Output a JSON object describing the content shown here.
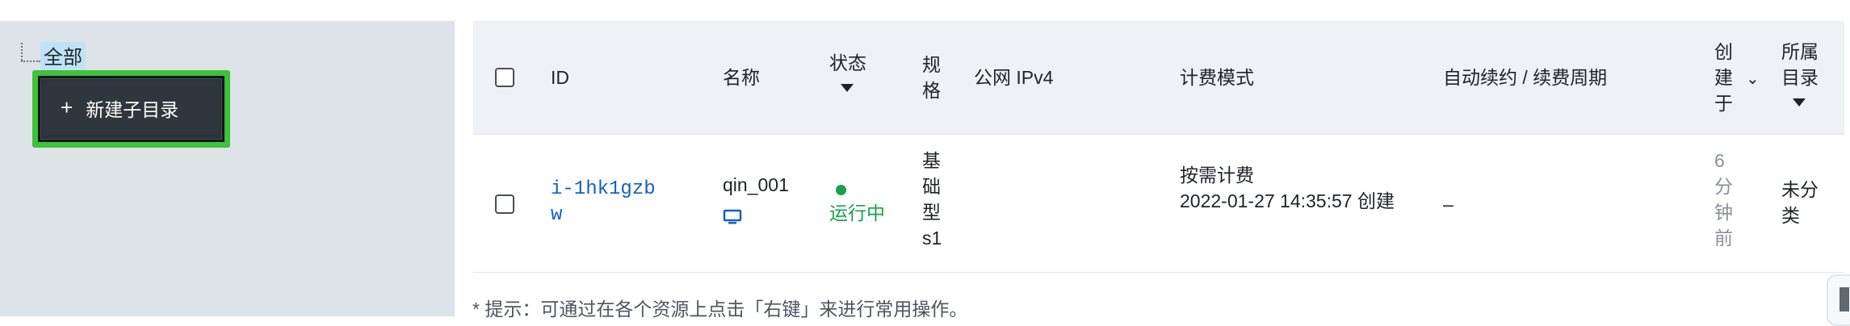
{
  "sidebar": {
    "root_label": "全部",
    "context_menu": {
      "items": [
        {
          "icon": "plus-icon",
          "icon_text": "+",
          "label": "新建子目录"
        }
      ]
    }
  },
  "table": {
    "headers": {
      "id": "ID",
      "name": "名称",
      "status": "状态",
      "spec": "规格",
      "ipv4": "公网 IPv4",
      "billing": "计费模式",
      "renew": "自动续约 / 续费周期",
      "created": "创建于",
      "folder": "所属目录"
    },
    "rows": [
      {
        "id": "i-1hk1gzbw",
        "name": "qin_001",
        "status": "运行中",
        "spec": "基础型s1",
        "ipv4": "",
        "billing_mode": "按需计费",
        "billing_time": "2022-01-27 14:35:57 创建",
        "renew": "–",
        "created": "6分钟前",
        "folder": "未分类"
      }
    ]
  },
  "hint": "* 提示：可通过在各个资源上点击「右键」来进行常用操作。",
  "colors": {
    "highlight": "#3ec23c",
    "link": "#1660c2",
    "running": "#16a34a",
    "sidebar_bg": "#dde3e9",
    "header_bg": "#eef1f5"
  }
}
